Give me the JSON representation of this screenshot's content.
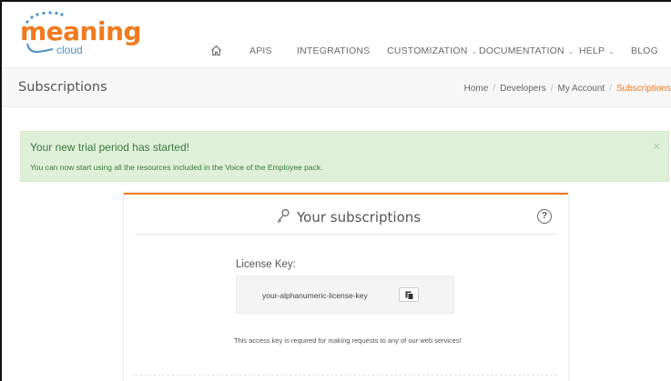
{
  "brand": {
    "logo_word": "meaning",
    "logo_sub": "cloud",
    "accent": "#f07a1e",
    "blue": "#4a93c7"
  },
  "nav": {
    "items": [
      {
        "label": "APIS",
        "dropdown": false
      },
      {
        "label": "INTEGRATIONS",
        "dropdown": false
      },
      {
        "label": "CUSTOMIZATION",
        "dropdown": true
      },
      {
        "label": "DOCUMENTATION",
        "dropdown": true
      },
      {
        "label": "HELP",
        "dropdown": true
      },
      {
        "label": "BLOG",
        "dropdown": false
      }
    ],
    "chevron": "⌄"
  },
  "titlebar": {
    "title": "Subscriptions",
    "breadcrumb": [
      "Home",
      "Developers",
      "My Account",
      "Subscriptions"
    ],
    "separator": "/"
  },
  "alert": {
    "title": "Your new trial period has started!",
    "text": "You can now start using all the resources included in the Voice of the Employee pack.",
    "close": "×",
    "color": "#3c763d"
  },
  "card": {
    "title": "Your subscriptions",
    "help": "?",
    "license_label": "License Key:",
    "license_key": "your-alphanumeric-license-key",
    "access_note": "This access key is required for making requests to any of our web services!"
  }
}
